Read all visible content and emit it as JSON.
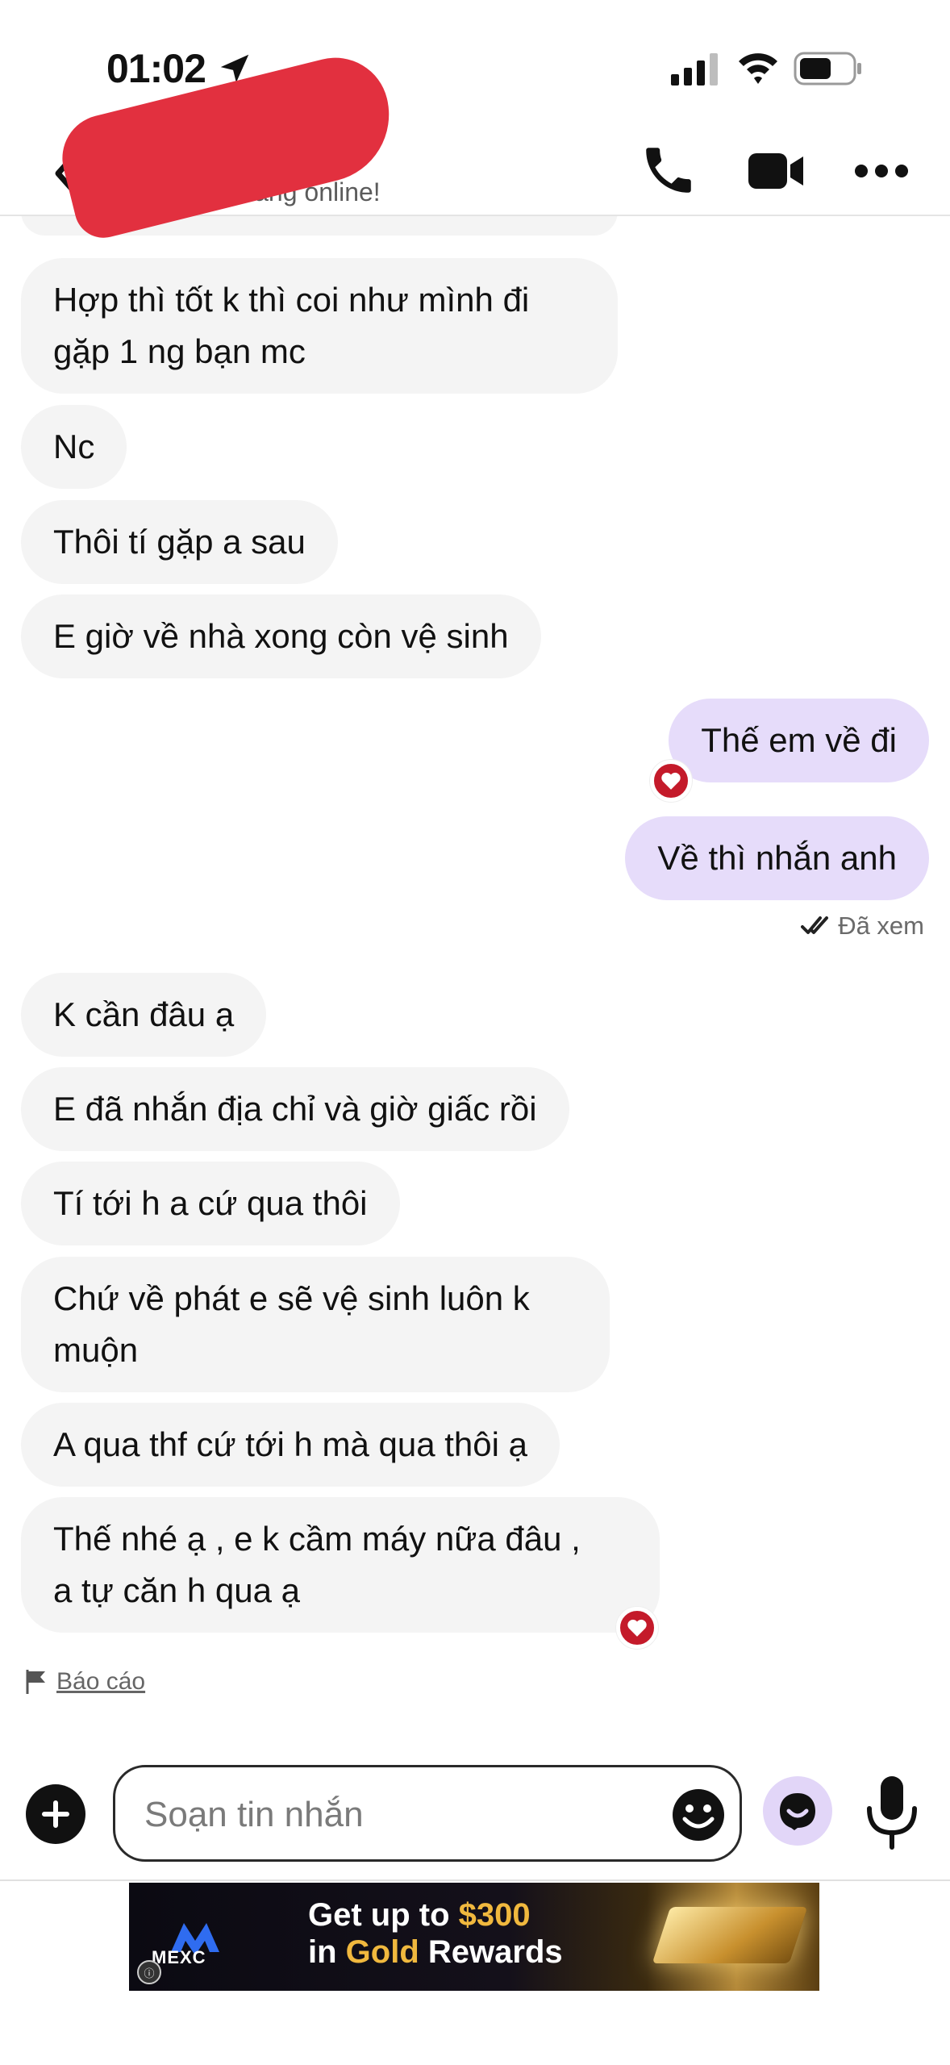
{
  "status_bar": {
    "time": "01:02"
  },
  "header": {
    "status": "Đang online!"
  },
  "messages": [
    {
      "side": "in",
      "lines": [
        "Hợp thì tốt k thì coi như mình đi",
        "gặp 1 ng bạn mc"
      ]
    },
    {
      "side": "in",
      "lines": [
        "Nc"
      ]
    },
    {
      "side": "in",
      "lines": [
        "Thôi tí gặp a sau"
      ]
    },
    {
      "side": "in",
      "lines": [
        "E giờ về nhà xong còn vệ sinh"
      ]
    },
    {
      "side": "out",
      "lines": [
        "Thế em về đi"
      ],
      "reaction": "heart"
    },
    {
      "side": "out",
      "lines": [
        "Về thì nhắn anh"
      ]
    },
    {
      "side": "in",
      "lines": [
        "K cần đâu ạ"
      ]
    },
    {
      "side": "in",
      "lines": [
        "E đã nhắn địa chỉ và giờ giấc rồi"
      ]
    },
    {
      "side": "in",
      "lines": [
        "Tí tới h a cứ qua thôi"
      ]
    },
    {
      "side": "in",
      "lines": [
        "Chứ về phát e sẽ vệ sinh luôn k",
        "muộn"
      ]
    },
    {
      "side": "in",
      "lines": [
        "A qua thf cứ tới h mà qua thôi ạ"
      ]
    },
    {
      "side": "in",
      "lines": [
        "Thế nhé ạ , e k cầm máy nữa đâu ,",
        "a tự căn h qua ạ"
      ],
      "reaction": "heart"
    }
  ],
  "seen_label": "Đã xem",
  "report_label": "Báo cáo",
  "composer": {
    "placeholder": "Soạn tin nhắn"
  },
  "ad": {
    "brand": "MEXC",
    "line1_a": "Get up to ",
    "line1_b": "$300",
    "line2_a": "in ",
    "line2_b": "Gold",
    "line2_c": " Rewards"
  },
  "colors": {
    "incoming_bubble": "#f4f4f4",
    "outgoing_bubble": "#e6dcfa",
    "reaction_heart": "#c41a2a",
    "accent_purple": "#e2d6f8"
  },
  "icons": [
    "location-arrow-icon",
    "signal-icon",
    "wifi-icon",
    "battery-icon",
    "back-icon",
    "phone-call-icon",
    "video-call-icon",
    "more-icon",
    "heart-reaction-icon",
    "double-check-icon",
    "flag-icon",
    "plus-icon",
    "emoji-icon",
    "bot-icon",
    "microphone-icon"
  ]
}
